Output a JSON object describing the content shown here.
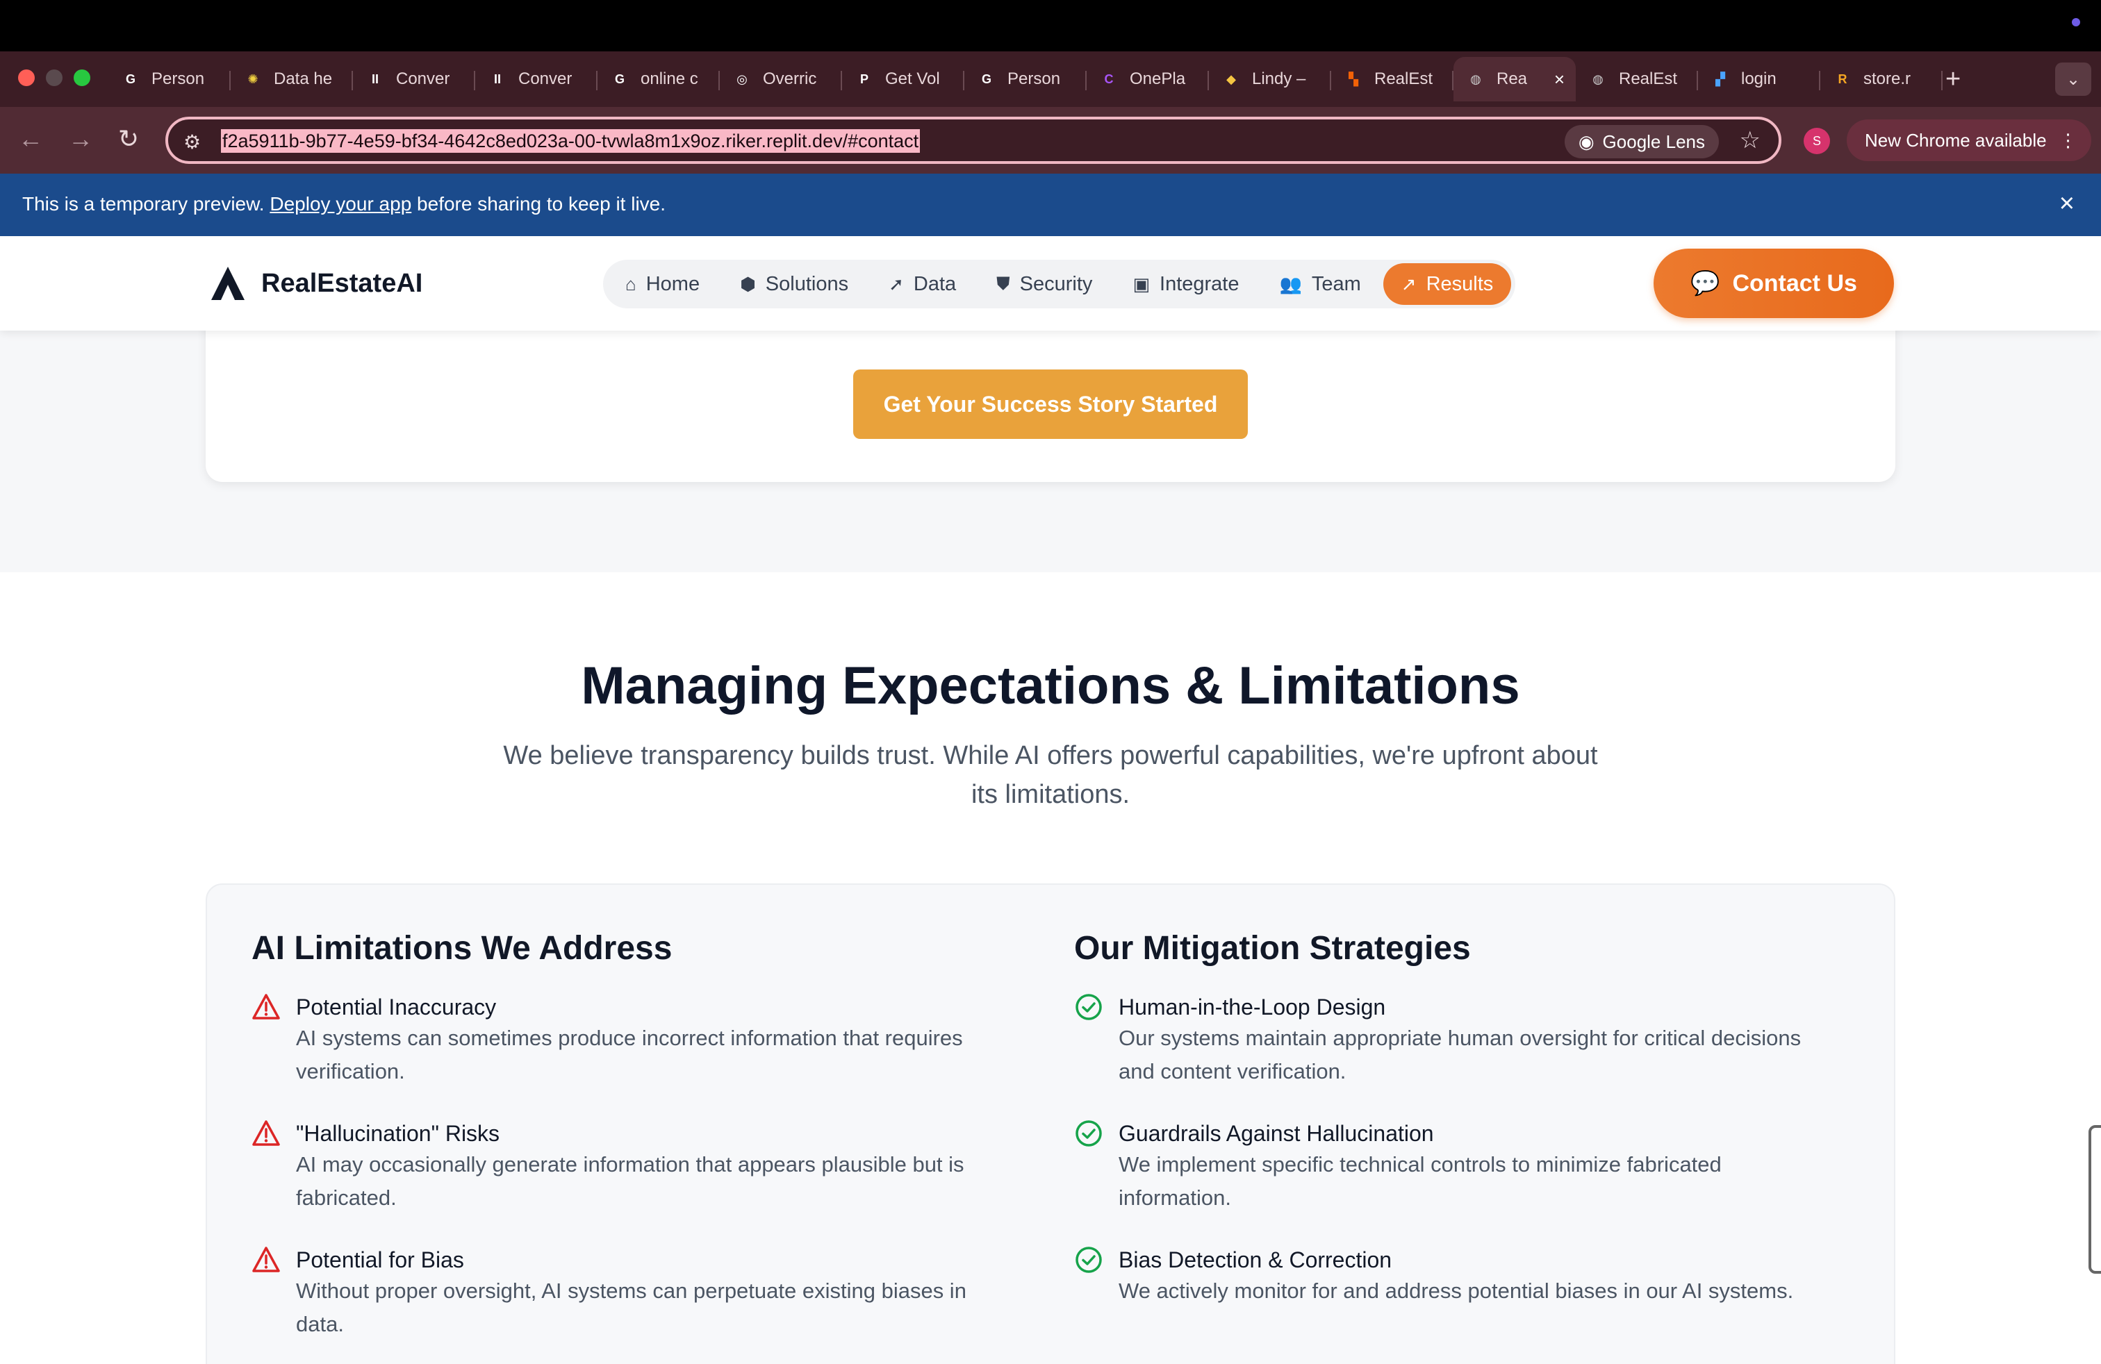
{
  "browser": {
    "tabs": [
      {
        "label": "Person",
        "favicon": "G",
        "color": "#ffffff"
      },
      {
        "label": "Data he",
        "favicon": "✺",
        "color": "#f0d040"
      },
      {
        "label": "Conver",
        "favicon": "II",
        "color": "#ffffff"
      },
      {
        "label": "Conver",
        "favicon": "II",
        "color": "#ffffff"
      },
      {
        "label": "online c",
        "favicon": "G",
        "color": "#ffffff"
      },
      {
        "label": "Overric",
        "favicon": "◎",
        "color": "#ffffff"
      },
      {
        "label": "Get Vol",
        "favicon": "P",
        "color": "#ffffff"
      },
      {
        "label": "Person",
        "favicon": "G",
        "color": "#ffffff"
      },
      {
        "label": "OnePla",
        "favicon": "C",
        "color": "#a855f7"
      },
      {
        "label": "Lindy –",
        "favicon": "◆",
        "color": "#f5c542"
      },
      {
        "label": "RealEst",
        "favicon": "▚",
        "color": "#f26207"
      },
      {
        "label": "Rea",
        "favicon": "◍",
        "color": "#cccccc",
        "active": true
      },
      {
        "label": "RealEst",
        "favicon": "◍",
        "color": "#cccccc"
      },
      {
        "label": "login",
        "favicon": "▞",
        "color": "#4aa3ff"
      },
      {
        "label": "store.r",
        "favicon": "R",
        "color": "#f5a623"
      }
    ],
    "url": "f2a5911b-9b77-4e59-bf34-4642c8ed023a-00-tvwla8m1x9oz.riker.replit.dev/#contact",
    "lens_label": "Google Lens",
    "profile_initial": "S",
    "update_label": "New Chrome available"
  },
  "banner": {
    "prefix": "This is a temporary preview.",
    "link": "Deploy your app",
    "suffix": "before sharing to keep it live."
  },
  "site": {
    "brand": "RealEstateAI",
    "nav": [
      {
        "label": "Home",
        "icon": "home-icon"
      },
      {
        "label": "Solutions",
        "icon": "cube-icon"
      },
      {
        "label": "Data",
        "icon": "pointer-icon"
      },
      {
        "label": "Security",
        "icon": "shield-icon"
      },
      {
        "label": "Integrate",
        "icon": "chip-icon"
      },
      {
        "label": "Team",
        "icon": "users-icon"
      },
      {
        "label": "Results",
        "icon": "trend-icon",
        "active": true
      }
    ],
    "contact_label": "Contact Us",
    "accent": "#ec7a2e"
  },
  "cta": {
    "button_label": "Get Your Success Story Started"
  },
  "section": {
    "title": "Managing Expectations & Limitations",
    "subtitle": "We believe transparency builds trust. While AI offers powerful capabilities, we're upfront about its limitations."
  },
  "limitations": {
    "heading": "AI Limitations We Address",
    "items": [
      {
        "title": "Potential Inaccuracy",
        "desc": "AI systems can sometimes produce incorrect information that requires verification."
      },
      {
        "title": "\"Hallucination\" Risks",
        "desc": "AI may occasionally generate information that appears plausible but is fabricated."
      },
      {
        "title": "Potential for Bias",
        "desc": "Without proper oversight, AI systems can perpetuate existing biases in data."
      }
    ]
  },
  "mitigation": {
    "heading": "Our Mitigation Strategies",
    "items": [
      {
        "title": "Human-in-the-Loop Design",
        "desc": "Our systems maintain appropriate human oversight for critical decisions and content verification."
      },
      {
        "title": "Guardrails Against Hallucination",
        "desc": "We implement specific technical controls to minimize fabricated information."
      },
      {
        "title": "Bias Detection & Correction",
        "desc": "We actively monitor for and address potential biases in our AI systems."
      }
    ]
  }
}
